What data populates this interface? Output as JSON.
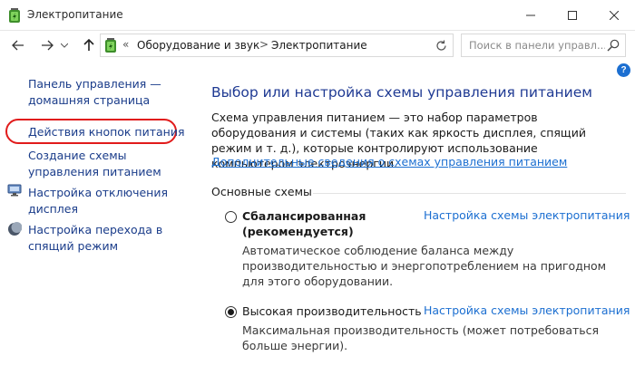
{
  "window": {
    "title": "Электропитание"
  },
  "address": {
    "prefix": "«",
    "crumbs": [
      "Оборудование и звук",
      "Электропитание"
    ],
    "separator": ">"
  },
  "search": {
    "placeholder": "Поиск в панели управл..."
  },
  "help_label": "?",
  "leftnav": {
    "home": "Панель управления — домашняя страница",
    "items": [
      {
        "label": "Действия кнопок питания",
        "icon": "none"
      },
      {
        "label": "Создание схемы управления питанием",
        "icon": "none"
      },
      {
        "label": "Настройка отключения дисплея",
        "icon": "monitor-icon"
      },
      {
        "label": "Настройка перехода в спящий режим",
        "icon": "moon-icon"
      }
    ]
  },
  "main": {
    "heading": "Выбор или настройка схемы управления питанием",
    "description": "Схема управления питанием — это набор параметров оборудования и системы (таких как яркость дисплея, спящий режим и т. д.), которые контролируют использование компьютером электроэнергии.",
    "more_info": "Дополнительные сведения о схемах управления питанием",
    "section_label": "Основные схемы",
    "plans": [
      {
        "name_line1": "Сбалансированная",
        "name_line2": "(рекомендуется)",
        "selected": false,
        "link": "Настройка схемы электропитания",
        "description": "Автоматическое соблюдение баланса между производительностью и энергопотреблением на пригодном для этого оборудовании."
      },
      {
        "name_line1": "Высокая производительность",
        "selected": true,
        "link": "Настройка схемы электропитания",
        "description": "Максимальная производительность (может потребоваться больше энергии)."
      }
    ]
  },
  "colors": {
    "link": "#1c6fd1",
    "heading": "#1f3a93",
    "highlight_ring": "#e11b1b"
  }
}
